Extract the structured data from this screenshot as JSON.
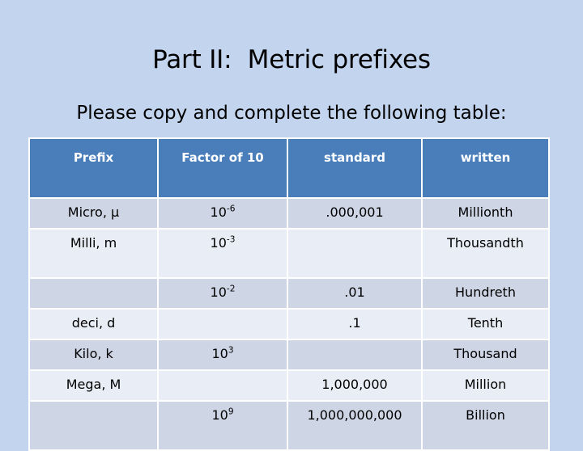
{
  "slide": {
    "title": "Part II:  Metric prefixes",
    "subtitle": "Please copy and complete the following table:",
    "background_color": "#c3d4ef",
    "header_color": "#4a7ebb",
    "band_dark_color": "#ced5e5",
    "band_light_color": "#e9edf5"
  },
  "table": {
    "headers": [
      "Prefix",
      "Factor of 10",
      "standard",
      "written"
    ],
    "rows": [
      {
        "prefix": "Micro, μ",
        "factor_base": "10",
        "factor_exponent": "-6",
        "standard": ".000,001",
        "written": "Millionth"
      },
      {
        "prefix": "Milli, m",
        "factor_base": "10",
        "factor_exponent": "-3",
        "standard": "",
        "written": "Thousandth"
      },
      {
        "prefix": "",
        "factor_base": "10",
        "factor_exponent": "-2",
        "standard": ".01",
        "written": "Hundreth"
      },
      {
        "prefix": "deci, d",
        "factor_base": "",
        "factor_exponent": "",
        "standard": ".1",
        "written": "Tenth"
      },
      {
        "prefix": "Kilo, k",
        "factor_base": "10",
        "factor_exponent": "3",
        "standard": "",
        "written": "Thousand"
      },
      {
        "prefix": "Mega, M",
        "factor_base": "",
        "factor_exponent": "",
        "standard": "1,000,000",
        "written": "Million"
      },
      {
        "prefix": "",
        "factor_base": "10",
        "factor_exponent": "9",
        "standard": "1,000,000,000",
        "written": "Billion"
      }
    ]
  }
}
